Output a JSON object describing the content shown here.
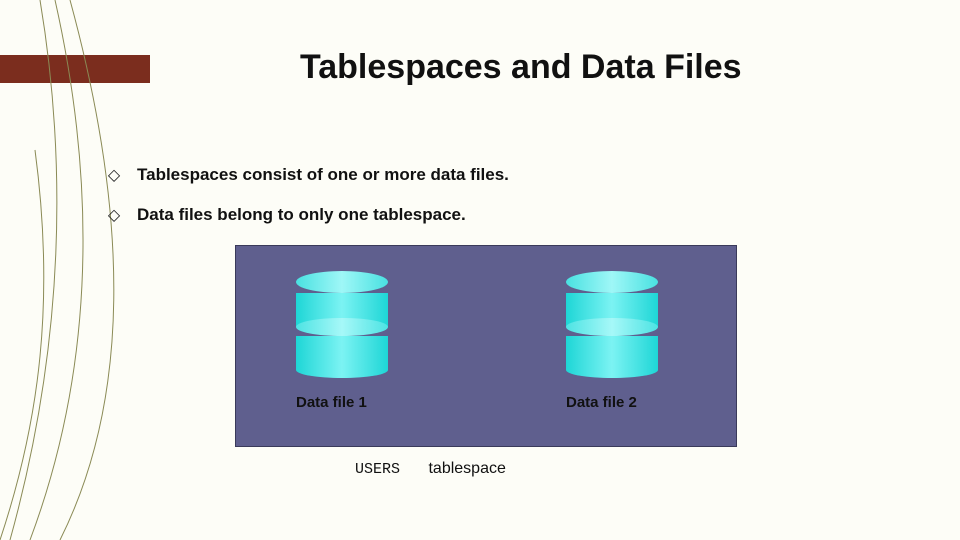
{
  "title": "Tablespaces and Data Files",
  "bullets": [
    "Tablespaces consist of one or more data files.",
    "Data files belong to only one tablespace."
  ],
  "diagram": {
    "datafile1_label": "Data file 1",
    "datafile2_label": "Data file 2",
    "caption_code": "USERS",
    "caption_text": "tablespace"
  },
  "colors": {
    "accent_bar": "#7b2d1e",
    "panel": "#5f5f8e",
    "cylinder": "#1ed6d6"
  }
}
